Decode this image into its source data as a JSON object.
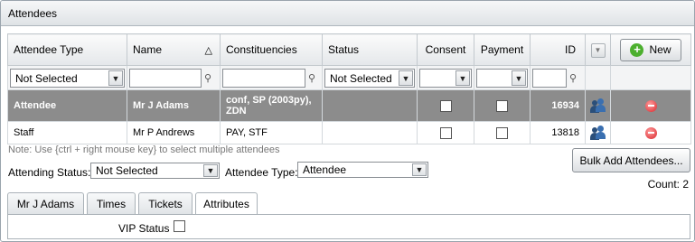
{
  "panel": {
    "title": "Attendees"
  },
  "grid": {
    "columns": {
      "attendee_type": "Attendee Type",
      "name": "Name",
      "constituencies": "Constituencies",
      "status": "Status",
      "consent": "Consent",
      "payment": "Payment",
      "id": "ID",
      "new_button": "New"
    },
    "filters": {
      "attendee_type": "Not Selected",
      "name": "",
      "constituencies": "",
      "status": "Not Selected",
      "consent": "",
      "payment": "",
      "id": ""
    },
    "rows": [
      {
        "type": "Attendee",
        "name": "Mr J Adams",
        "constituencies": "conf, SP (2003py), ZDN",
        "status": "",
        "id": "16934"
      },
      {
        "type": "Staff",
        "name": "Mr P Andrews",
        "constituencies": "PAY, STF",
        "status": "",
        "id": "13818"
      }
    ]
  },
  "note": "Note: Use {ctrl + right mouse key} to select multiple attendees",
  "attending_status": {
    "label": "Attending Status:",
    "value": "Not Selected"
  },
  "attendee_type": {
    "label": "Attendee Type:",
    "value": "Attendee"
  },
  "bulk_add_button": "Bulk Add Attendees...",
  "count": "Count: 2",
  "tabs": [
    "Mr J Adams",
    "Times",
    "Tickets",
    "Attributes"
  ],
  "attributes": {
    "vip_label": "VIP Status"
  }
}
